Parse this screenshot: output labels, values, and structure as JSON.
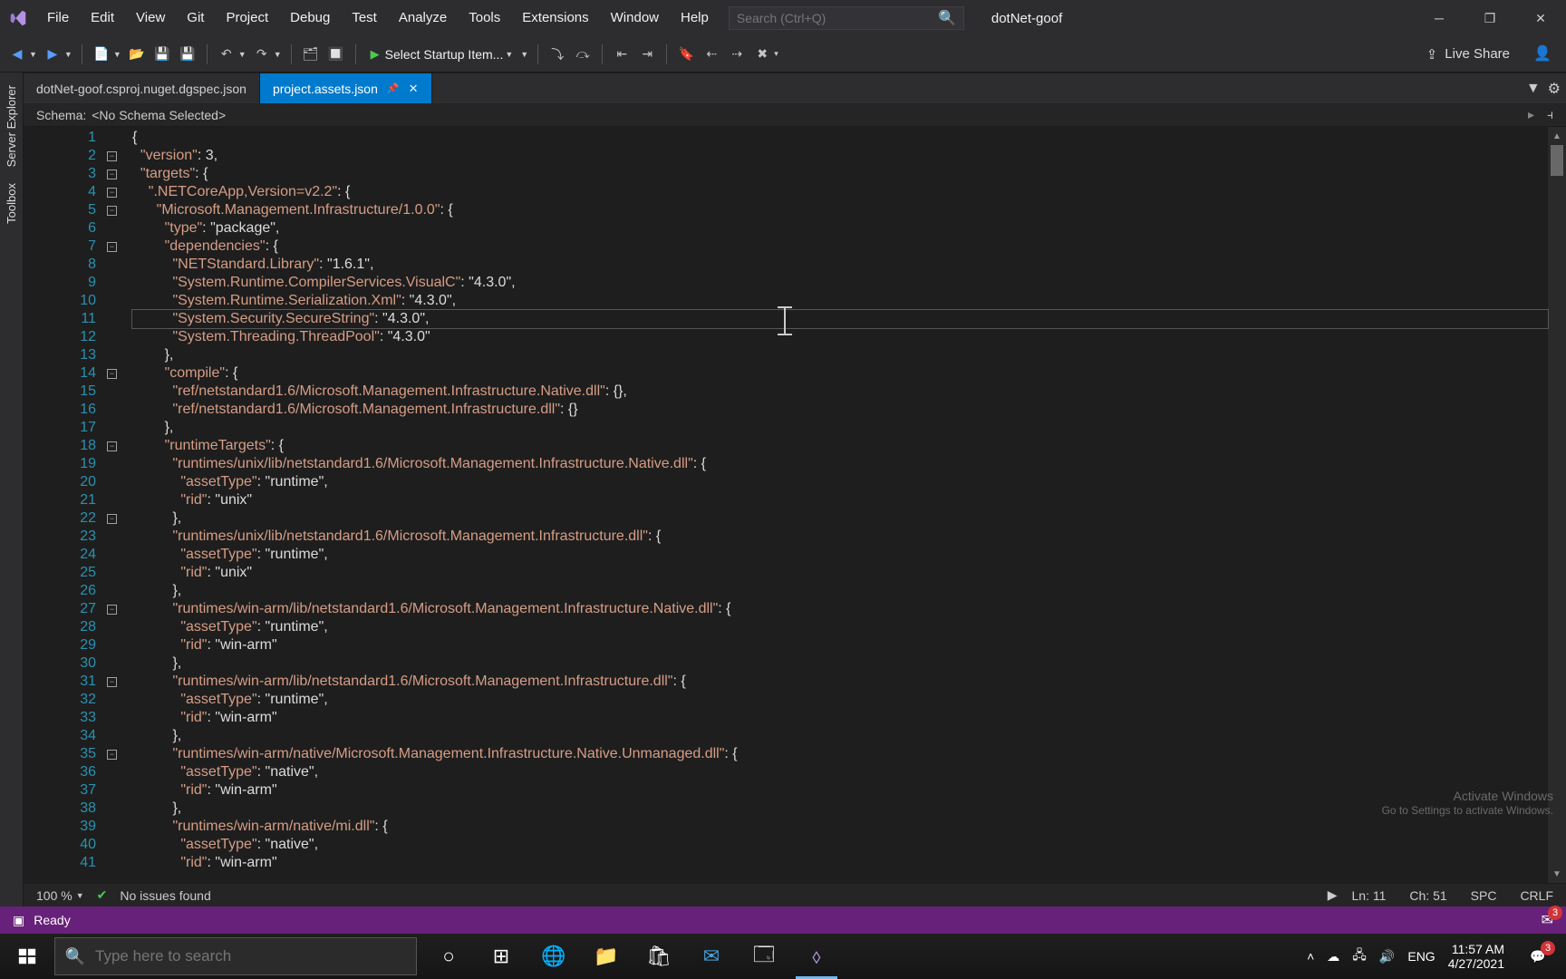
{
  "menu": [
    "File",
    "Edit",
    "View",
    "Git",
    "Project",
    "Debug",
    "Test",
    "Analyze",
    "Tools",
    "Extensions",
    "Window",
    "Help"
  ],
  "search": {
    "placeholder": "Search (Ctrl+Q)"
  },
  "solution": "dotNet-goof",
  "startup": "Select Startup Item...",
  "liveshare": "Live Share",
  "siderail": [
    "Server Explorer",
    "Toolbox"
  ],
  "tabs": [
    {
      "label": "dotNet-goof.csproj.nuget.dgspec.json",
      "active": false
    },
    {
      "label": "project.assets.json",
      "active": true
    }
  ],
  "schema_label": "Schema:",
  "schema_value": "<No Schema Selected>",
  "code": {
    "start_line": 1,
    "highlighted_line": 11,
    "fold_lines": [
      1,
      2,
      3,
      4,
      6,
      13,
      17,
      21,
      26,
      30,
      34
    ],
    "lines": [
      "{",
      "  \"version\": 3,",
      "  \"targets\": {",
      "    \".NETCoreApp,Version=v2.2\": {",
      "      \"Microsoft.Management.Infrastructure/1.0.0\": {",
      "        \"type\": \"package\",",
      "        \"dependencies\": {",
      "          \"NETStandard.Library\": \"1.6.1\",",
      "          \"System.Runtime.CompilerServices.VisualC\": \"4.3.0\",",
      "          \"System.Runtime.Serialization.Xml\": \"4.3.0\",",
      "          \"System.Security.SecureString\": \"4.3.0\",",
      "          \"System.Threading.ThreadPool\": \"4.3.0\"",
      "        },",
      "        \"compile\": {",
      "          \"ref/netstandard1.6/Microsoft.Management.Infrastructure.Native.dll\": {},",
      "          \"ref/netstandard1.6/Microsoft.Management.Infrastructure.dll\": {}",
      "        },",
      "        \"runtimeTargets\": {",
      "          \"runtimes/unix/lib/netstandard1.6/Microsoft.Management.Infrastructure.Native.dll\": {",
      "            \"assetType\": \"runtime\",",
      "            \"rid\": \"unix\"",
      "          },",
      "          \"runtimes/unix/lib/netstandard1.6/Microsoft.Management.Infrastructure.dll\": {",
      "            \"assetType\": \"runtime\",",
      "            \"rid\": \"unix\"",
      "          },",
      "          \"runtimes/win-arm/lib/netstandard1.6/Microsoft.Management.Infrastructure.Native.dll\": {",
      "            \"assetType\": \"runtime\",",
      "            \"rid\": \"win-arm\"",
      "          },",
      "          \"runtimes/win-arm/lib/netstandard1.6/Microsoft.Management.Infrastructure.dll\": {",
      "            \"assetType\": \"runtime\",",
      "            \"rid\": \"win-arm\"",
      "          },",
      "          \"runtimes/win-arm/native/Microsoft.Management.Infrastructure.Native.Unmanaged.dll\": {",
      "            \"assetType\": \"native\",",
      "            \"rid\": \"win-arm\"",
      "          },",
      "          \"runtimes/win-arm/native/mi.dll\": {",
      "            \"assetType\": \"native\",",
      "            \"rid\": \"win-arm\""
    ]
  },
  "zoom": "100 %",
  "issues": "No issues found",
  "pos": {
    "ln": "Ln: 11",
    "ch": "Ch: 51",
    "spc": "SPC",
    "crlf": "CRLF"
  },
  "status": "Ready",
  "notif_count": "3",
  "task_search": "Type here to search",
  "lang": "ENG",
  "clock": {
    "time": "11:57 AM",
    "date": "4/27/2021"
  },
  "tray_notif": "3",
  "watermark1": "Activate Windows",
  "watermark2": "Go to Settings to activate Windows."
}
